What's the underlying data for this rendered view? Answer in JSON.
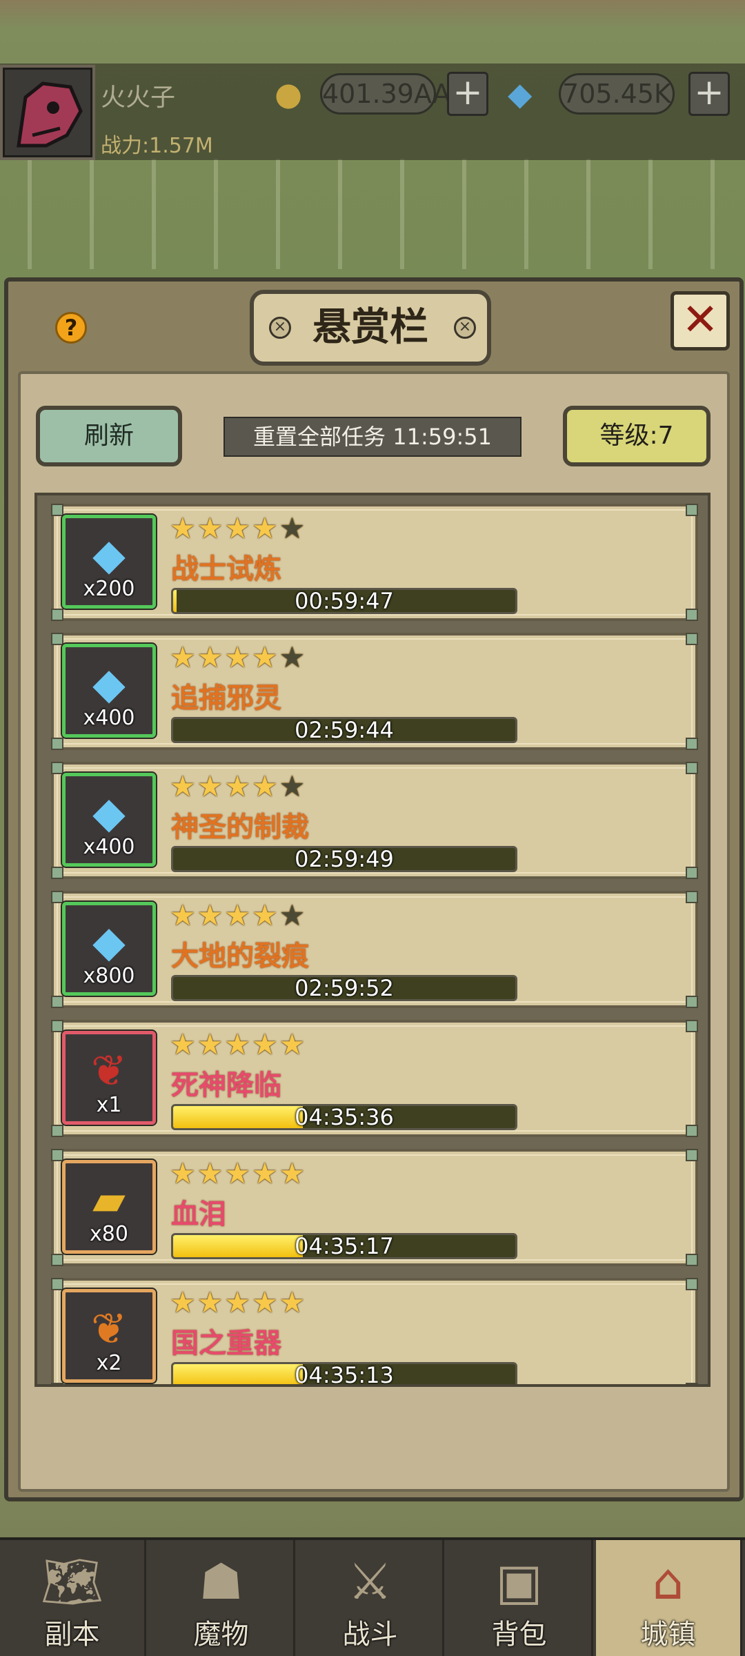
{
  "header": {
    "player_name": "火火子",
    "power_label": "战力:1.57M",
    "gold": {
      "icon": "coin-icon",
      "value": "401.39AA",
      "plus": "+"
    },
    "diamond": {
      "icon": "diamond-icon",
      "value": "705.45K",
      "plus": "+"
    }
  },
  "dialog": {
    "title": "悬赏栏",
    "help": "?",
    "close": "✕",
    "refresh_label": "刷新",
    "reset_text": "重置全部任务 11:59:51",
    "level_label": "等级:7"
  },
  "quests": [
    {
      "reward_icon": "diamond-icon",
      "reward_qty": "x200",
      "stars_filled": 4,
      "stars_total": 5,
      "name": "战士试炼",
      "timer": "00:59:47",
      "progress": 0.01,
      "rarity": "green"
    },
    {
      "reward_icon": "diamond-icon",
      "reward_qty": "x400",
      "stars_filled": 4,
      "stars_total": 5,
      "name": "追捕邪灵",
      "timer": "02:59:44",
      "progress": 0.0,
      "rarity": "green"
    },
    {
      "reward_icon": "diamond-icon",
      "reward_qty": "x400",
      "stars_filled": 4,
      "stars_total": 5,
      "name": "神圣的制裁",
      "timer": "02:59:49",
      "progress": 0.0,
      "rarity": "green"
    },
    {
      "reward_icon": "diamond-icon",
      "reward_qty": "x800",
      "stars_filled": 4,
      "stars_total": 5,
      "name": "大地的裂痕",
      "timer": "02:59:52",
      "progress": 0.0,
      "rarity": "green"
    },
    {
      "reward_icon": "red-feather-icon",
      "reward_qty": "x1",
      "stars_filled": 5,
      "stars_total": 5,
      "name": "死神降临",
      "timer": "04:35:36",
      "progress": 0.38,
      "rarity": "red"
    },
    {
      "reward_icon": "gold-scroll-icon",
      "reward_qty": "x80",
      "stars_filled": 5,
      "stars_total": 5,
      "name": "血泪",
      "timer": "04:35:17",
      "progress": 0.38,
      "rarity": "orange"
    },
    {
      "reward_icon": "orange-feather-icon",
      "reward_qty": "x2",
      "stars_filled": 5,
      "stars_total": 5,
      "name": "国之重器",
      "timer": "04:35:13",
      "progress": 0.38,
      "rarity": "orange"
    }
  ],
  "nav": [
    {
      "label": "副本",
      "icon": "map-icon"
    },
    {
      "label": "魔物",
      "icon": "monster-icon"
    },
    {
      "label": "战斗",
      "icon": "crossed-swords-icon"
    },
    {
      "label": "背包",
      "icon": "backpack-icon"
    },
    {
      "label": "城镇",
      "icon": "town-icon",
      "active": true
    }
  ]
}
